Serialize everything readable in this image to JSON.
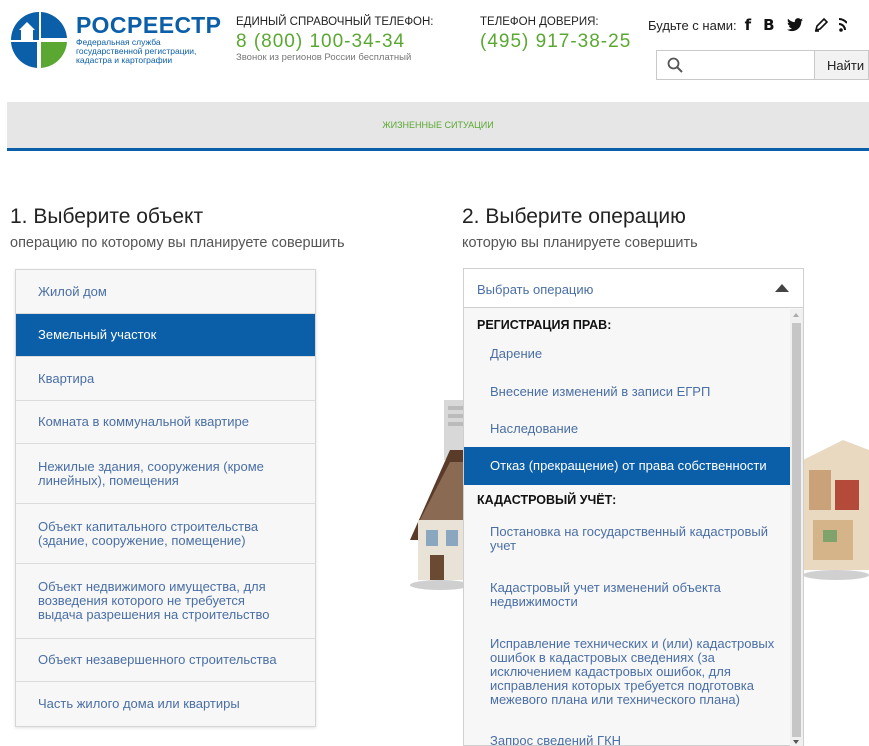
{
  "header": {
    "brand_name": "РОСРЕЕСТР",
    "brand_sub": "Федеральная служба государственной регистрации, кадастра и картографии",
    "hotline_label": "ЕДИНЫЙ СПРАВОЧНЫЙ ТЕЛЕФОН:",
    "hotline_number": "8 (800) 100-34-34",
    "hotline_note": "Звонок из регионов России бесплатный",
    "trust_label": "ТЕЛЕФОН ДОВЕРИЯ:",
    "trust_number": "(495) 917-38-25",
    "social_label": "Будьте с нами:",
    "social_icons": [
      "facebook-icon",
      "vk-icon",
      "twitter-icon",
      "blog-icon",
      "rss-icon"
    ],
    "search_placeholder": "",
    "search_button": "Найти"
  },
  "nav": {
    "items": [
      "ЖИЗНЕННЫЕ СИТУАЦИИ"
    ]
  },
  "step1": {
    "title": "1. Выберите объект",
    "subtitle": "операцию по которому вы планируете совершить",
    "items": [
      {
        "label": "Жилой дом",
        "active": false
      },
      {
        "label": "Земельный участок",
        "active": true
      },
      {
        "label": "Квартира",
        "active": false
      },
      {
        "label": "Комната в коммунальной квартире",
        "active": false
      },
      {
        "label": "Нежилые здания, сооружения (кроме линейных), помещения",
        "active": false
      },
      {
        "label": "Объект капитального строительства (здание, сооружение, помещение)",
        "active": false
      },
      {
        "label": "Объект недвижимого имущества, для возведения которого не требуется выдача разрешения на строительство",
        "active": false
      },
      {
        "label": "Объект незавершенного строительства",
        "active": false
      },
      {
        "label": "Часть жилого дома или квартиры",
        "active": false
      }
    ]
  },
  "step2": {
    "title": "2. Выберите операцию",
    "subtitle": "которую вы планируете совершить",
    "select_label": "Выбрать операцию",
    "groups": [
      {
        "title": "РЕГИСТРАЦИЯ ПРАВ:",
        "items": [
          {
            "label": "Дарение",
            "active": false
          },
          {
            "label": "Внесение изменений в записи ЕГРП",
            "active": false
          },
          {
            "label": "Наследование",
            "active": false
          },
          {
            "label": "Отказ (прекращение) от права собственности",
            "active": true
          }
        ]
      },
      {
        "title": "КАДАСТРОВЫЙ УЧЁТ:",
        "items": [
          {
            "label": "Постановка на государственный кадастровый учет",
            "active": false
          },
          {
            "label": "Кадастровый учет изменений объекта недвижимости",
            "active": false
          },
          {
            "label": "Исправление технических и (или) кадастровых ошибок в кадастровых сведениях (за исключением кадастровых ошибок, для исправления которых требуется подготовка межевого плана или технического плана)",
            "active": false
          },
          {
            "label": "Запрос сведений ГКН",
            "active": false
          }
        ]
      }
    ]
  },
  "colors": {
    "brand_blue": "#0b5ea8",
    "accent_green": "#5aa832",
    "link_blue": "#4a6fa5"
  }
}
